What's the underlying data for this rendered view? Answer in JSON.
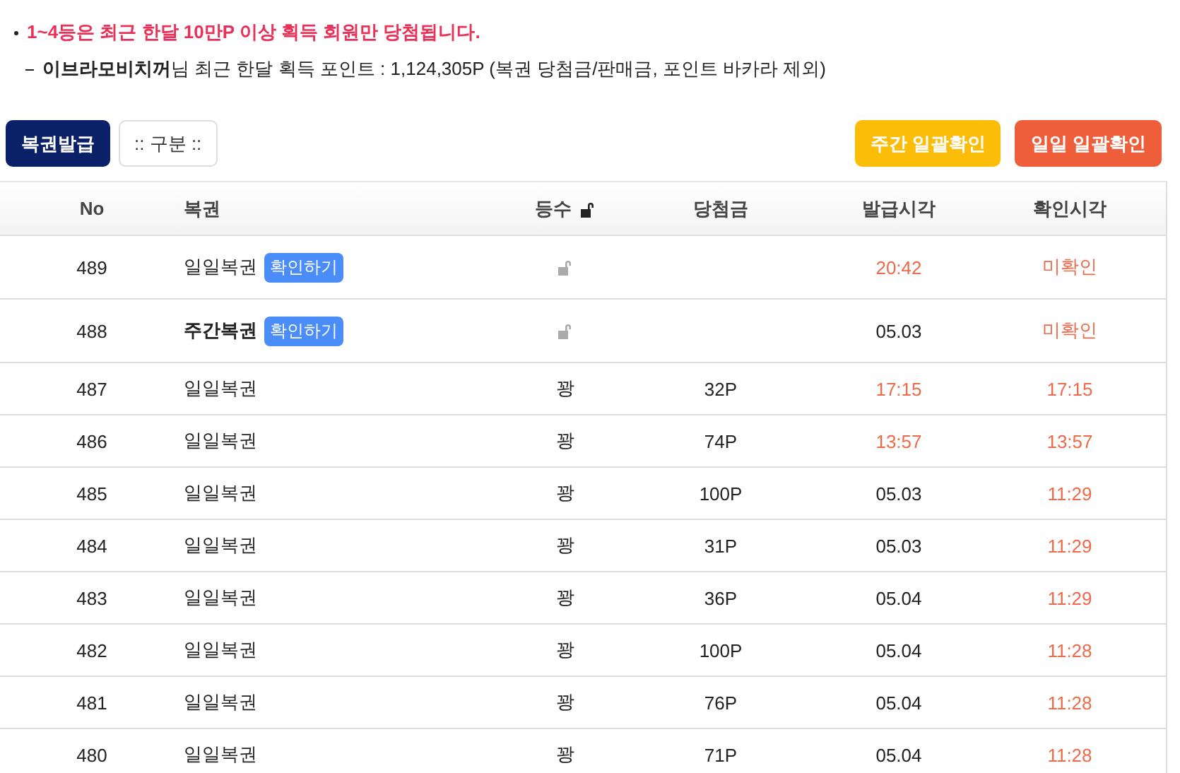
{
  "notices": [
    {
      "kind": "alert",
      "text": "1~4등은 최근 한달 10만P 이상 획득 회원만 당첨됩니다."
    },
    {
      "kind": "info",
      "text": "**이브라모비치꺼**님 최근 한달 획득 포인트 : 1,124,305P (복권 당첨금/판매금, 포인트 바카라 제외)"
    }
  ],
  "toolbar": {
    "issue_button": "복권발급",
    "filter": ":: 구분 ::",
    "weekly_confirm_button": "주간 일괄확인",
    "daily_confirm_button": "일일 일괄확인"
  },
  "table": {
    "columns": [
      "No",
      "복권",
      "등수",
      "당첨금",
      "발급시각",
      "확인시각"
    ],
    "rows": [
      {
        "no": "489",
        "name": "일일복권",
        "kind": "daily",
        "check_button": "확인하기",
        "locked": true,
        "issued": "20:42",
        "issued_recent": true,
        "confirmed": "미확인",
        "confirmed_recent": true
      },
      {
        "no": "488",
        "name": "주간복권",
        "kind": "weekly",
        "check_button": "확인하기",
        "locked": true,
        "issued": "05.03",
        "issued_recent": false,
        "confirmed": "미확인",
        "confirmed_recent": true
      },
      {
        "no": "487",
        "name": "일일복권",
        "kind": "daily",
        "locked": false,
        "rank": "꽝",
        "prize": "32P",
        "issued": "17:15",
        "issued_recent": true,
        "confirmed": "17:15",
        "confirmed_recent": true
      },
      {
        "no": "486",
        "name": "일일복권",
        "kind": "daily",
        "locked": false,
        "rank": "꽝",
        "prize": "74P",
        "issued": "13:57",
        "issued_recent": true,
        "confirmed": "13:57",
        "confirmed_recent": true
      },
      {
        "no": "485",
        "name": "일일복권",
        "kind": "daily",
        "locked": false,
        "rank": "꽝",
        "prize": "100P",
        "issued": "05.03",
        "issued_recent": false,
        "confirmed": "11:29",
        "confirmed_recent": true
      },
      {
        "no": "484",
        "name": "일일복권",
        "kind": "daily",
        "locked": false,
        "rank": "꽝",
        "prize": "31P",
        "issued": "05.03",
        "issued_recent": false,
        "confirmed": "11:29",
        "confirmed_recent": true
      },
      {
        "no": "483",
        "name": "일일복권",
        "kind": "daily",
        "locked": false,
        "rank": "꽝",
        "prize": "36P",
        "issued": "05.04",
        "issued_recent": false,
        "confirmed": "11:29",
        "confirmed_recent": true
      },
      {
        "no": "482",
        "name": "일일복권",
        "kind": "daily",
        "locked": false,
        "rank": "꽝",
        "prize": "100P",
        "issued": "05.04",
        "issued_recent": false,
        "confirmed": "11:28",
        "confirmed_recent": true
      },
      {
        "no": "481",
        "name": "일일복권",
        "kind": "daily",
        "locked": false,
        "rank": "꽝",
        "prize": "76P",
        "issued": "05.04",
        "issued_recent": false,
        "confirmed": "11:28",
        "confirmed_recent": true
      },
      {
        "no": "480",
        "name": "일일복권",
        "kind": "daily",
        "locked": false,
        "rank": "꽝",
        "prize": "71P",
        "issued": "05.04",
        "issued_recent": false,
        "confirmed": "11:28",
        "confirmed_recent": true
      }
    ]
  }
}
